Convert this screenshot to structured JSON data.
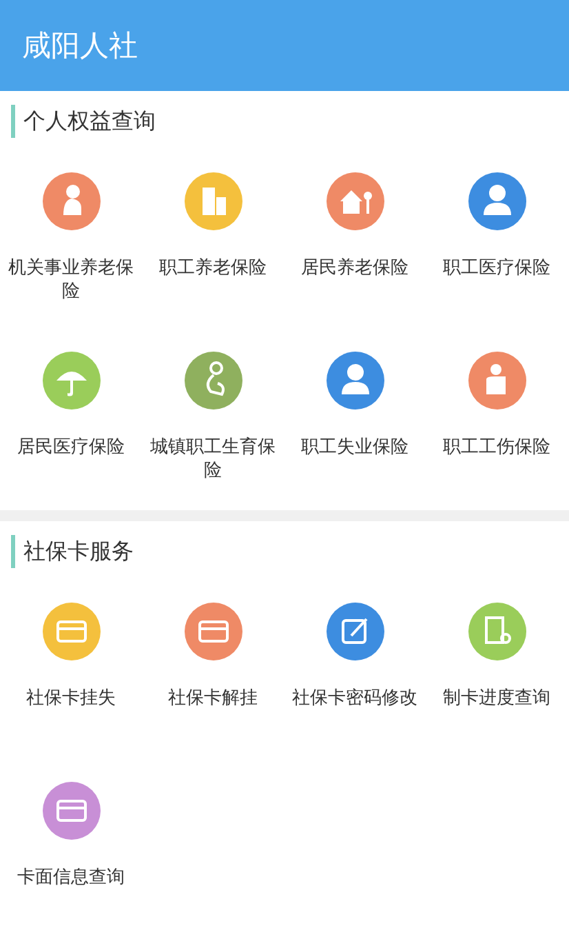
{
  "header": {
    "title": "咸阳人社"
  },
  "sections": [
    {
      "title": "个人权益查询",
      "items": [
        {
          "label": "机关事业养老保险",
          "kind": "elder",
          "color": "#ef8a66"
        },
        {
          "label": "职工养老保险",
          "kind": "building",
          "color": "#f4c03d"
        },
        {
          "label": "居民养老保险",
          "kind": "house",
          "color": "#ef8a66"
        },
        {
          "label": "职工医疗保险",
          "kind": "person",
          "color": "#3d8de0"
        },
        {
          "label": "居民医疗保险",
          "kind": "umbrella",
          "color": "#9acd5a"
        },
        {
          "label": "城镇职工生育保险",
          "kind": "mother",
          "color": "#8fb05e"
        },
        {
          "label": "职工失业保险",
          "kind": "worker",
          "color": "#3d8de0"
        },
        {
          "label": "职工工伤保险",
          "kind": "injury",
          "color": "#ef8a66"
        }
      ]
    },
    {
      "title": "社保卡服务",
      "items": [
        {
          "label": "社保卡挂失",
          "kind": "cardlock",
          "color": "#f4c03d"
        },
        {
          "label": "社保卡解挂",
          "kind": "cardunlink",
          "color": "#ef8a66"
        },
        {
          "label": "社保卡密码修改",
          "kind": "edit",
          "color": "#3d8de0"
        },
        {
          "label": "制卡进度查询",
          "kind": "docsearch",
          "color": "#9acd5a"
        },
        {
          "label": "卡面信息查询",
          "kind": "card",
          "color": "#c88fd6"
        }
      ]
    }
  ]
}
